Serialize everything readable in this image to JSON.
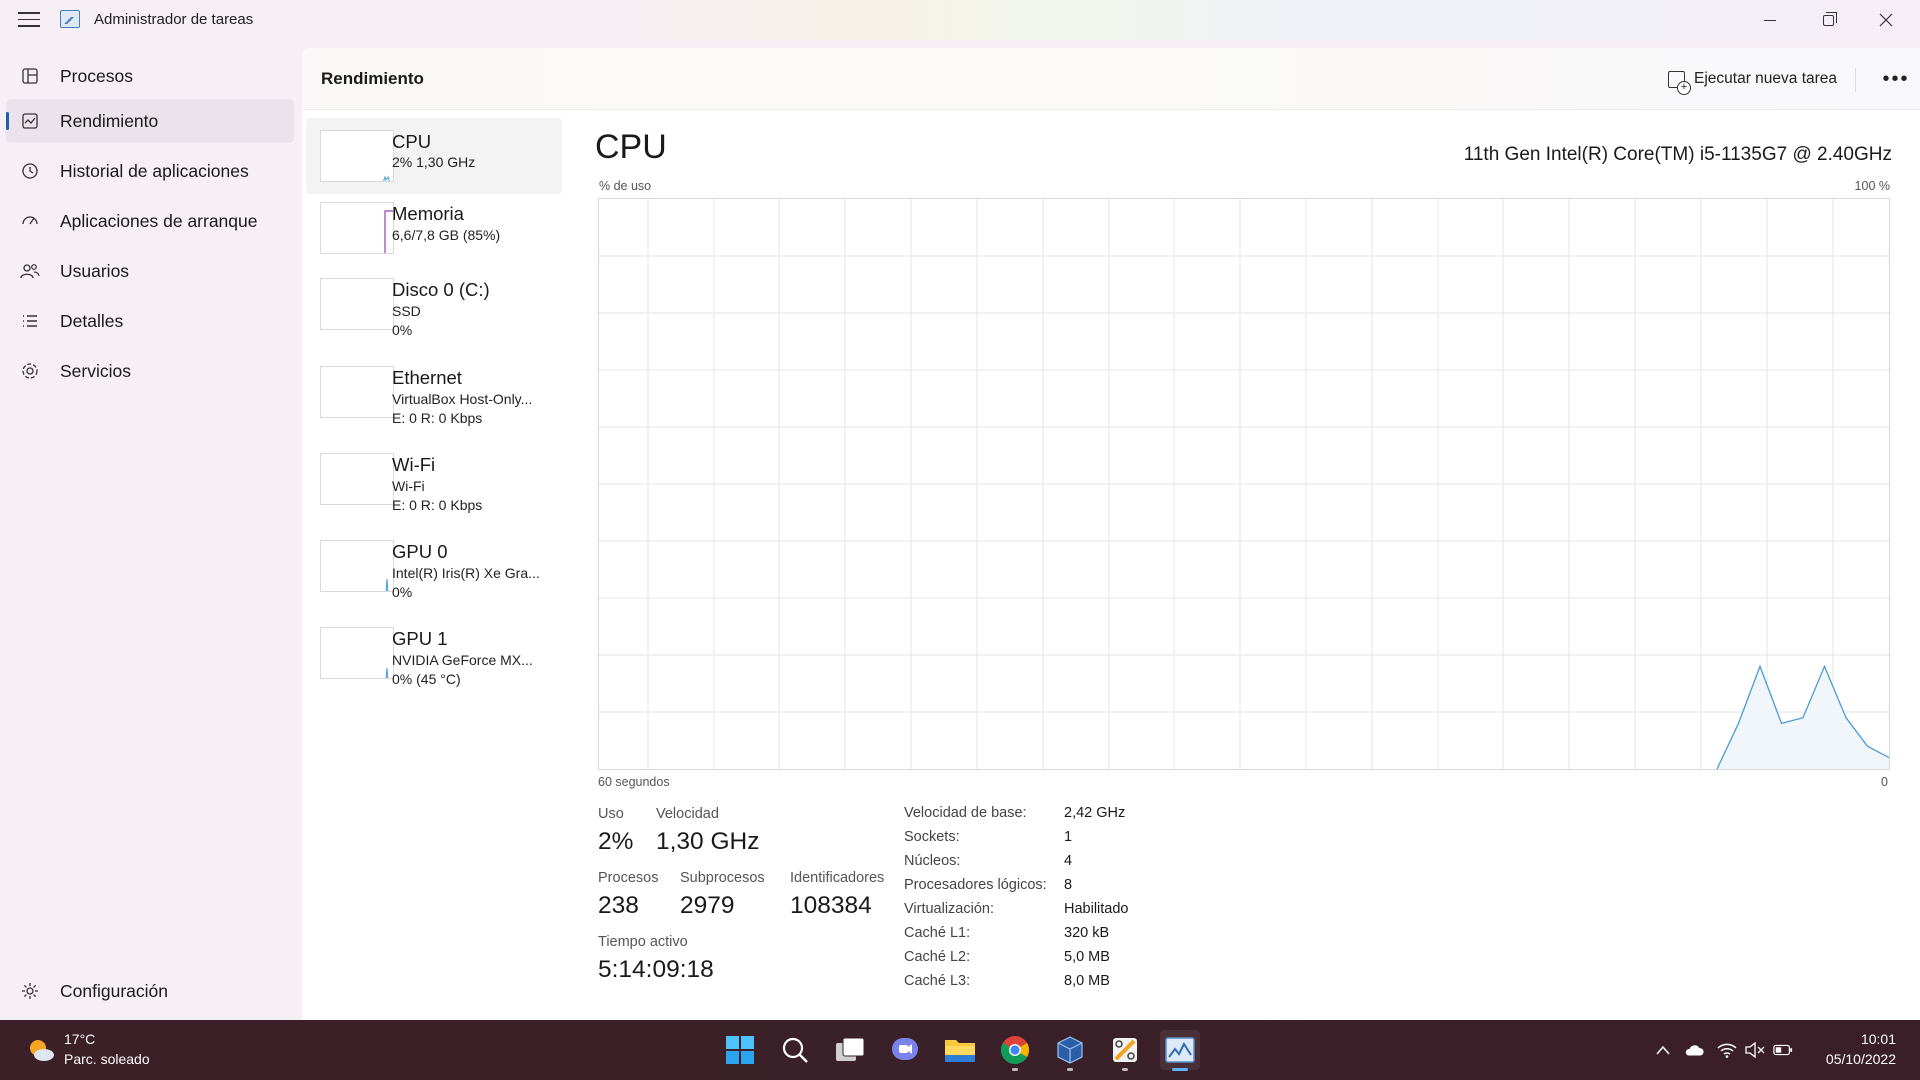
{
  "window": {
    "title": "Administrador de tareas"
  },
  "sidebar": {
    "items": [
      {
        "label": "Procesos",
        "icon": "processes-icon"
      },
      {
        "label": "Rendimiento",
        "icon": "performance-icon"
      },
      {
        "label": "Historial de aplicaciones",
        "icon": "history-icon"
      },
      {
        "label": "Aplicaciones de arranque",
        "icon": "startup-icon"
      },
      {
        "label": "Usuarios",
        "icon": "users-icon"
      },
      {
        "label": "Detalles",
        "icon": "details-icon"
      },
      {
        "label": "Servicios",
        "icon": "services-icon"
      }
    ],
    "active_index": 1,
    "settings_label": "Configuración"
  },
  "header": {
    "title": "Rendimiento",
    "run_task_label": "Ejecutar nueva tarea"
  },
  "resources": [
    {
      "name": "CPU",
      "line1": "2% 1,30 GHz",
      "line2": ""
    },
    {
      "name": "Memoria",
      "line1": "6,6/7,8 GB (85%)",
      "line2": ""
    },
    {
      "name": "Disco 0 (C:)",
      "line1": "SSD",
      "line2": "0%"
    },
    {
      "name": "Ethernet",
      "line1": "VirtualBox Host-Only...",
      "line2": "E: 0 R: 0 Kbps"
    },
    {
      "name": "Wi-Fi",
      "line1": "Wi-Fi",
      "line2": "E: 0 R: 0 Kbps"
    },
    {
      "name": "GPU 0",
      "line1": "Intel(R) Iris(R) Xe Gra...",
      "line2": "0%"
    },
    {
      "name": "GPU 1",
      "line1": "NVIDIA GeForce MX...",
      "line2": "0% (45 °C)"
    }
  ],
  "detail": {
    "title": "CPU",
    "model": "11th Gen Intel(R) Core(TM) i5-1135G7 @ 2.40GHz",
    "axis_top_left": "% de uso",
    "axis_top_right": "100 %",
    "axis_bottom_left": "60 segundos",
    "axis_bottom_right": "0",
    "stats": {
      "uso_label": "Uso",
      "uso_value": "2%",
      "velocidad_label": "Velocidad",
      "velocidad_value": "1,30 GHz",
      "procesos_label": "Procesos",
      "procesos_value": "238",
      "subprocesos_label": "Subprocesos",
      "subprocesos_value": "2979",
      "identificadores_label": "Identificadores",
      "identificadores_value": "108384",
      "tiempo_label": "Tiempo activo",
      "tiempo_value": "5:14:09:18"
    },
    "specs": [
      {
        "label": "Velocidad de base:",
        "value": "2,42 GHz"
      },
      {
        "label": "Sockets:",
        "value": "1"
      },
      {
        "label": "Núcleos:",
        "value": "4"
      },
      {
        "label": "Procesadores lógicos:",
        "value": "8"
      },
      {
        "label": "Virtualización:",
        "value": "Habilitado"
      },
      {
        "label": "Caché L1:",
        "value": "320 kB"
      },
      {
        "label": "Caché L2:",
        "value": "5,0 MB"
      },
      {
        "label": "Caché L3:",
        "value": "8,0 MB"
      }
    ]
  },
  "chart_data": {
    "type": "area",
    "x": [
      60,
      59,
      58,
      57,
      56,
      55,
      54,
      53,
      52,
      51,
      50,
      49,
      48,
      47,
      46,
      45,
      44,
      43,
      42,
      41,
      40,
      39,
      38,
      37,
      36,
      35,
      34,
      33,
      32,
      31,
      30,
      29,
      28,
      27,
      26,
      25,
      24,
      23,
      22,
      21,
      20,
      19,
      18,
      17,
      16,
      15,
      14,
      13,
      12,
      11,
      10,
      9,
      8,
      7,
      6,
      5,
      4,
      3,
      2,
      1,
      0
    ],
    "values": [
      0,
      0,
      0,
      0,
      0,
      0,
      0,
      0,
      0,
      0,
      0,
      0,
      0,
      0,
      0,
      0,
      0,
      0,
      0,
      0,
      0,
      0,
      0,
      0,
      0,
      0,
      0,
      0,
      0,
      0,
      0,
      0,
      0,
      0,
      0,
      0,
      0,
      0,
      0,
      0,
      0,
      0,
      0,
      0,
      0,
      0,
      0,
      0,
      0,
      0,
      0,
      0,
      0,
      8,
      18,
      8,
      9,
      18,
      9,
      4,
      2
    ],
    "xlim": [
      60,
      0
    ],
    "ylim": [
      0,
      100
    ],
    "xlabel": "60 segundos",
    "ylabel": "% de uso",
    "grid": true,
    "color": "#4a9ad6"
  },
  "taskbar": {
    "weather_temp": "17°C",
    "weather_desc": "Parc. soleado",
    "clock_time": "10:01",
    "clock_date": "05/10/2022",
    "apps": [
      {
        "name": "start-icon",
        "active": false,
        "running": false
      },
      {
        "name": "search-icon",
        "active": false,
        "running": false
      },
      {
        "name": "task-view-icon",
        "active": false,
        "running": false
      },
      {
        "name": "teams-chat-icon",
        "active": false,
        "running": false
      },
      {
        "name": "file-explorer-icon",
        "active": false,
        "running": false
      },
      {
        "name": "chrome-icon",
        "active": false,
        "running": true
      },
      {
        "name": "virtualbox-icon",
        "active": false,
        "running": true
      },
      {
        "name": "scissors-tool-icon",
        "active": false,
        "running": true
      },
      {
        "name": "task-manager-icon",
        "active": true,
        "running": true
      }
    ]
  }
}
